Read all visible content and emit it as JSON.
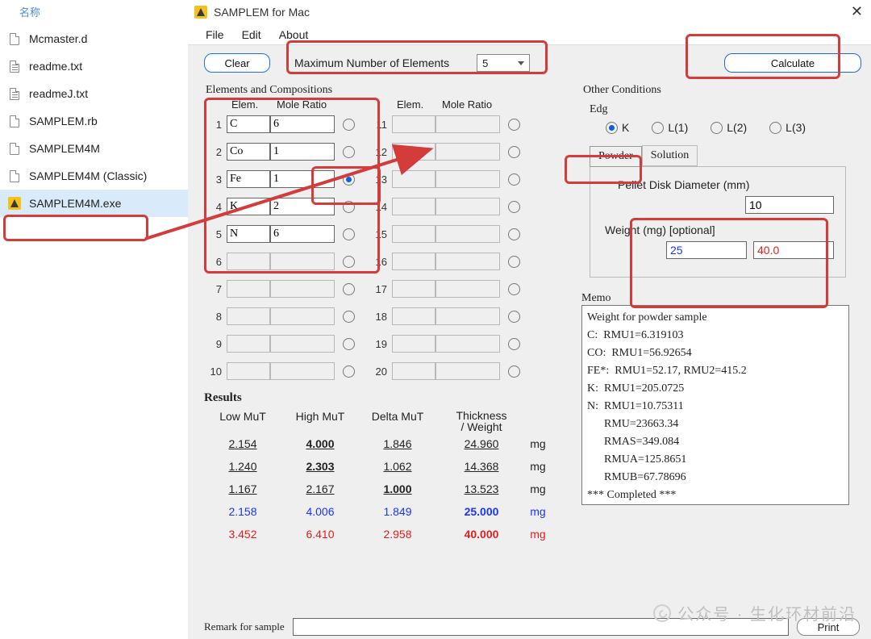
{
  "file_panel": {
    "header": "名称",
    "items": [
      {
        "name": "Mcmaster.d",
        "icon": "doc"
      },
      {
        "name": "readme.txt",
        "icon": "txt"
      },
      {
        "name": "readmeJ.txt",
        "icon": "txt"
      },
      {
        "name": "SAMPLEM.rb",
        "icon": "doc"
      },
      {
        "name": "SAMPLEM4M",
        "icon": "doc"
      },
      {
        "name": "SAMPLEM4M (Classic)",
        "icon": "doc"
      },
      {
        "name": "SAMPLEM4M.exe",
        "icon": "exe",
        "selected": true
      }
    ]
  },
  "window": {
    "title": "SAMPLEM for Mac"
  },
  "menu": {
    "file": "File",
    "edit": "Edit",
    "about": "About"
  },
  "toolbar": {
    "clear": "Clear",
    "max_label": "Maximum Number of Elements",
    "max_value": "5",
    "calculate": "Calculate"
  },
  "elements_label": "Elements and Compositions",
  "other_label": "Other Conditions",
  "headers": {
    "elem": "Elem.",
    "mole": "Mole Ratio"
  },
  "rows_left": [
    {
      "n": "1",
      "elem": "C",
      "mole": "6",
      "sel": false
    },
    {
      "n": "2",
      "elem": "Co",
      "mole": "1",
      "sel": false
    },
    {
      "n": "3",
      "elem": "Fe",
      "mole": "1",
      "sel": true
    },
    {
      "n": "4",
      "elem": "K",
      "mole": "2",
      "sel": false
    },
    {
      "n": "5",
      "elem": "N",
      "mole": "6",
      "sel": false
    },
    {
      "n": "6",
      "elem": "",
      "mole": "",
      "sel": false,
      "disabled": true
    },
    {
      "n": "7",
      "elem": "",
      "mole": "",
      "sel": false,
      "disabled": true
    },
    {
      "n": "8",
      "elem": "",
      "mole": "",
      "sel": false,
      "disabled": true
    },
    {
      "n": "9",
      "elem": "",
      "mole": "",
      "sel": false,
      "disabled": true
    },
    {
      "n": "10",
      "elem": "",
      "mole": "",
      "sel": false,
      "disabled": true
    }
  ],
  "rows_right_nums": [
    "11",
    "12",
    "13",
    "14",
    "15",
    "16",
    "17",
    "18",
    "19",
    "20"
  ],
  "edge": {
    "label": "Edg",
    "opts": [
      "K",
      "L(1)",
      "L(2)",
      "L(3)"
    ],
    "selected": "K"
  },
  "tabs": {
    "powder": "Powder",
    "solution": "Solution",
    "active": "powder"
  },
  "powder": {
    "diameter_label": "Pellet Disk Diameter (mm)",
    "diameter": "10",
    "weight_label": "Weight (mg) [optional]",
    "w1": "25",
    "w2": "40.0"
  },
  "memo_label": "Memo",
  "memo": "Weight for powder sample\nC:  RMU1=6.319103\nCO:  RMU1=56.92654\nFE*:  RMU1=52.17, RMU2=415.2\nK:  RMU1=205.0725\nN:  RMU1=10.75311\n      RMU=23663.34\n      RMAS=349.084\n      RMUA=125.8651\n      RMUB=67.78696\n*** Completed ***",
  "results": {
    "label": "Results",
    "head": {
      "low": "Low MuT",
      "high": "High MuT",
      "delta": "Delta MuT",
      "tw": "Thickness\n/ Weight"
    },
    "rows": [
      {
        "low": "2.154",
        "high": "4.000",
        "delta": "1.846",
        "tw": "24.960",
        "unit": "mg",
        "cls": "ul",
        "bold": "high"
      },
      {
        "low": "1.240",
        "high": "2.303",
        "delta": "1.062",
        "tw": "14.368",
        "unit": "mg",
        "cls": "ul",
        "bold": "high"
      },
      {
        "low": "1.167",
        "high": "2.167",
        "delta": "1.000",
        "tw": "13.523",
        "unit": "mg",
        "cls": "ul",
        "bold": "delta"
      },
      {
        "low": "2.158",
        "high": "4.006",
        "delta": "1.849",
        "tw": "25.000",
        "unit": "mg",
        "cls": "blue",
        "bold": "tw"
      },
      {
        "low": "3.452",
        "high": "6.410",
        "delta": "2.958",
        "tw": "40.000",
        "unit": "mg",
        "cls": "red",
        "bold": "tw"
      }
    ]
  },
  "remark": {
    "label": "Remark for sample",
    "print": "Print"
  },
  "watermark": "公众号 · 生化环材前沿"
}
